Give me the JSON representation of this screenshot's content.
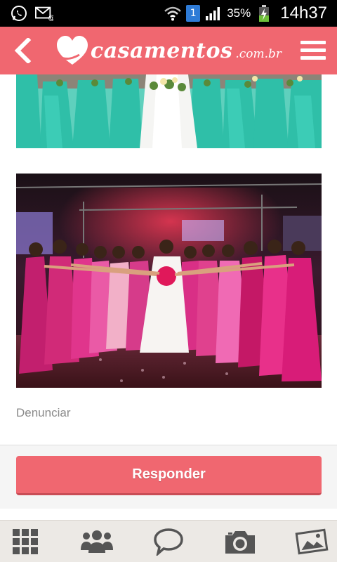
{
  "status_bar": {
    "sim_number": "1",
    "battery_percent": "35%",
    "time": "14h37"
  },
  "header": {
    "logo_text": "casamentos",
    "logo_domain": ".com.br",
    "brand_color": "#f06770"
  },
  "post": {
    "report_label": "Denunciar",
    "reply_label": "Responder"
  },
  "bottom_nav": {
    "items": [
      "grid-icon",
      "community-icon",
      "chat-icon",
      "camera-icon",
      "gallery-icon"
    ]
  }
}
